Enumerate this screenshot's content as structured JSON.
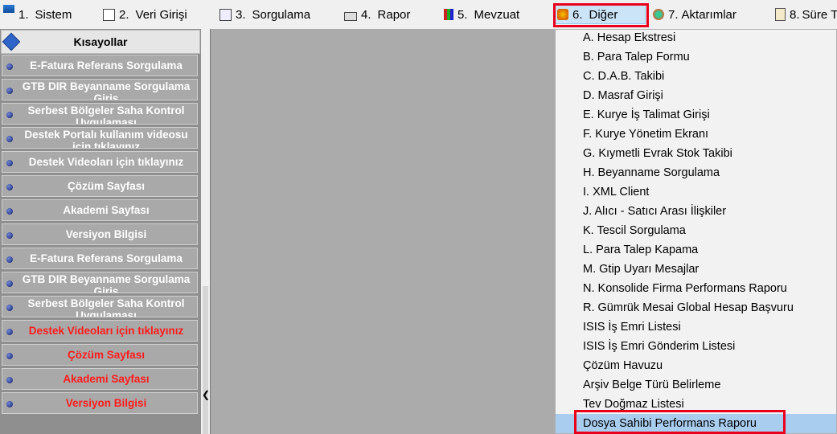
{
  "menu": [
    {
      "num": "1.",
      "label": "Sistem",
      "icon": "system-app-icon"
    },
    {
      "num": "2.",
      "label": "Veri Girişi",
      "icon": "data-entry-icon"
    },
    {
      "num": "3.",
      "label": "Sorgulama",
      "icon": "query-icon"
    },
    {
      "num": "4.",
      "label": "Rapor",
      "icon": "printer-icon"
    },
    {
      "num": "5.",
      "label": "Mevzuat",
      "icon": "books-icon"
    },
    {
      "num": "6.",
      "label": "Diğer",
      "icon": "other-tools-icon"
    },
    {
      "num": "7.",
      "label": "Aktarımlar",
      "icon": "transfer-gear-icon"
    },
    {
      "num": "8.",
      "label": "Süre Ta",
      "icon": "clipboard-icon"
    }
  ],
  "active_menu": "6. Diğer",
  "sidebar": {
    "title": "Kısayollar",
    "items": [
      {
        "label": "E-Fatura Referans Sorgulama",
        "color": "white"
      },
      {
        "label": "GTB DIR Beyanname Sorgulama Giriş",
        "color": "white"
      },
      {
        "label": "Serbest Bölgeler Saha Kontrol Uygulaması",
        "color": "white"
      },
      {
        "label": "Destek Portalı kullanım videosu için tıklayınız",
        "color": "white"
      },
      {
        "label": "Destek Videoları için tıklayınız",
        "color": "white"
      },
      {
        "label": "Çözüm Sayfası",
        "color": "white"
      },
      {
        "label": "Akademi Sayfası",
        "color": "white"
      },
      {
        "label": "Versiyon Bilgisi",
        "color": "white"
      },
      {
        "label": "E-Fatura Referans Sorgulama",
        "color": "white"
      },
      {
        "label": "GTB DIR Beyanname Sorgulama Giriş",
        "color": "white"
      },
      {
        "label": "Serbest Bölgeler Saha Kontrol Uygulaması",
        "color": "white"
      },
      {
        "label": "Destek Videoları için tıklayınız",
        "color": "red"
      },
      {
        "label": "Çözüm Sayfası",
        "color": "red"
      },
      {
        "label": "Akademi Sayfası",
        "color": "red"
      },
      {
        "label": "Versiyon Bilgisi",
        "color": "red"
      }
    ]
  },
  "dropdown": {
    "items": [
      "A.   Hesap Ekstresi",
      "B.   Para Talep Formu",
      "C.   D.A.B. Takibi",
      "D.   Masraf Girişi",
      "E.   Kurye İş Talimat Girişi",
      "F.   Kurye Yönetim Ekranı",
      "G.   Kıymetli Evrak Stok Takibi",
      "H.   Beyanname Sorgulama",
      "I.    XML Client",
      "J.   Alıcı - Satıcı Arası İlişkiler",
      "K.  Tescil Sorgulama",
      "L. Para Talep Kapama",
      "M. Gtip Uyarı Mesajlar",
      "N. Konsolide Firma Performans Raporu",
      "R. Gümrük Mesai Global Hesap Başvuru",
      "ISIS İş Emri Listesi",
      "ISIS İş Emri Gönderim Listesi",
      "Çözüm Havuzu",
      "Arşiv Belge Türü Belirleme",
      "Tev Doğmaz Listesi",
      "Dosya Sahibi Performans Raporu"
    ],
    "selected_index": 20
  },
  "colors": {
    "highlight_border": "#e8001c",
    "selected_bg": "#a9cdef",
    "sidebar_text": "#ffffff",
    "sidebar_text_red": "#ff1a1a"
  }
}
